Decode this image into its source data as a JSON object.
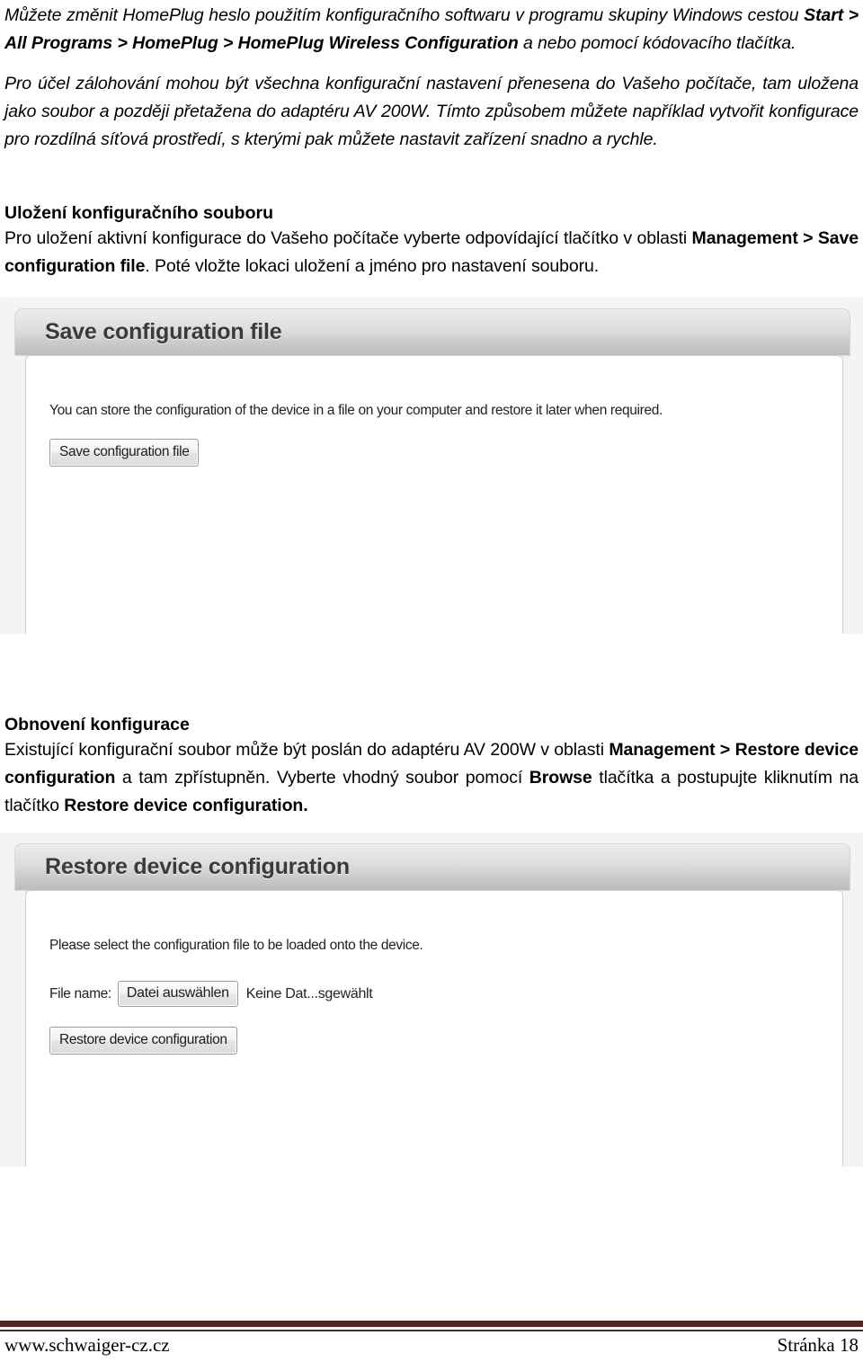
{
  "document": {
    "paragraphs": {
      "intro_prefix": "Můžete změnit HomePlug heslo použitím konfiguračního softwaru v programu skupiny Windows cestou ",
      "intro_bold": "Start > All Programs > HomePlug > HomePlug Wireless Configuration",
      "intro_suffix": " a nebo pomocí kódovacího tlačítka.",
      "backup": "Pro účel zálohování mohou být všechna konfigurační nastavení přenesena do Vašeho počítače, tam uložena jako soubor a později přetažena do adaptéru AV 200W. Tímto způsobem můžete například vytvořit konfigurace pro rozdílná síťová prostředí, s kterými pak můžete nastavit zařízení snadno a rychle.",
      "save_heading": "Uložení konfiguračního souboru",
      "save_prefix": "Pro uložení aktivní konfigurace do Vašeho počítače vyberte odpovídající tlačítko v oblasti ",
      "save_bold": "Management > Save configuration file",
      "save_suffix": ". Poté vložte lokaci uložení a jméno pro nastavení souboru.",
      "restore_heading": "Obnovení konfigurace",
      "restore_part1": "Existující konfigurační soubor může být poslán do adaptéru AV 200W v oblasti ",
      "restore_bold1": "Management > Restore device configuration",
      "restore_part2": " a tam zpřístupněn. Vyberte vhodný soubor pomocí ",
      "restore_bold2": "Browse",
      "restore_part3": " tlačítka a postupujte kliknutím na tlačítko ",
      "restore_bold3": "Restore device configuration."
    }
  },
  "screenshot_save": {
    "panel_title": "Save configuration file",
    "description": "You can store the configuration of the device in a file on your computer and restore it later when required.",
    "button_label": "Save configuration file"
  },
  "screenshot_restore": {
    "panel_title": "Restore device configuration",
    "description": "Please select the configuration file to be loaded onto the device.",
    "file_label": "File name:",
    "file_button_label": "Datei auswählen",
    "file_status": "Keine Dat...sgewählt",
    "button_label": "Restore device configuration"
  },
  "footer": {
    "url": "www.schwaiger-cz.cz",
    "page": "Stránka 18",
    "rule_color": "#5b2222"
  }
}
